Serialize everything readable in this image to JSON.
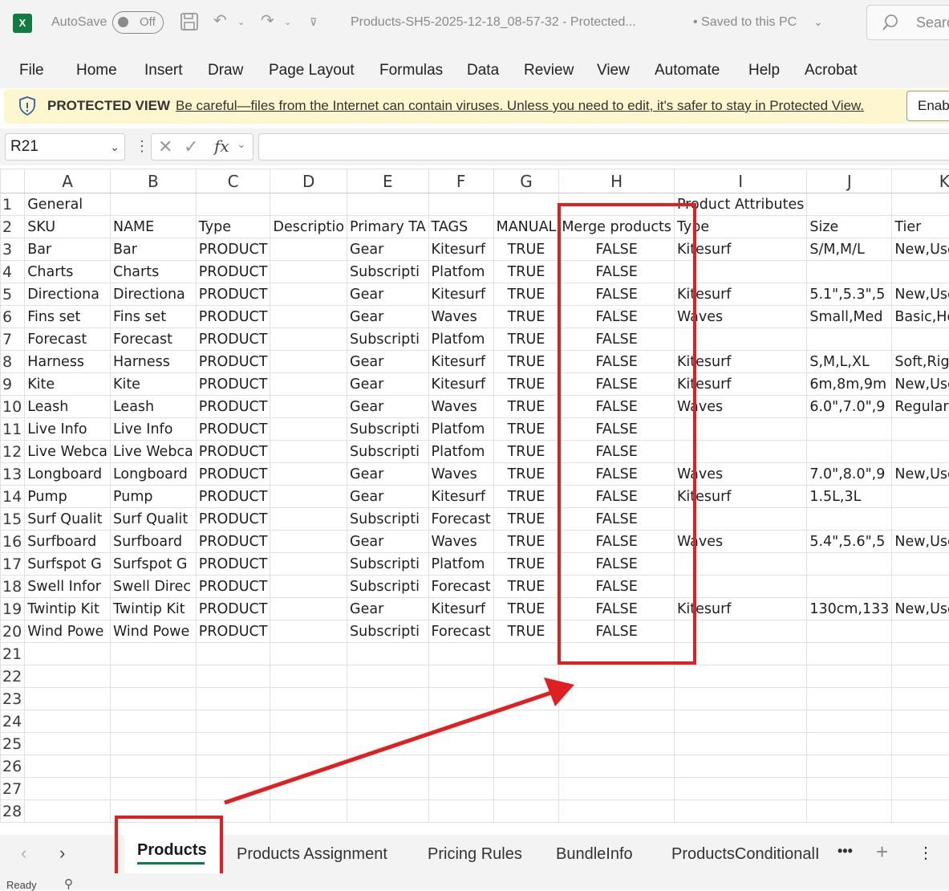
{
  "titlebar": {
    "autosave_label": "AutoSave",
    "toggle_label": "Off",
    "filename": "Products-SH5-2025-12-18_08-57-32  -  Protected...",
    "saved_status": "•  Saved to this PC",
    "search_placeholder": "Searc"
  },
  "menu": [
    "File",
    "Home",
    "Insert",
    "Draw",
    "Page Layout",
    "Formulas",
    "Data",
    "Review",
    "View",
    "Automate",
    "Help",
    "Acrobat"
  ],
  "protected_view": {
    "label": "PROTECTED VIEW",
    "message": "Be careful—files from the Internet can contain viruses. Unless you need to edit, it's safer to stay in Protected View.",
    "button": "Enabl"
  },
  "formula_bar": {
    "name_box": "R21",
    "fx": "fx",
    "formula": ""
  },
  "columns": [
    "A",
    "B",
    "C",
    "D",
    "E",
    "F",
    "G",
    "H",
    "I",
    "J",
    "K"
  ],
  "rows": [
    [
      "General",
      "",
      "",
      "",
      "",
      "",
      "",
      "",
      "Product Attributes",
      "",
      ""
    ],
    [
      "SKU",
      "NAME",
      "Type",
      "Descriptio",
      "Primary TA",
      "TAGS",
      "MANUAL",
      "Merge products",
      "Type",
      "Size",
      "Tier"
    ],
    [
      "Bar",
      "Bar",
      "PRODUCT",
      "",
      "Gear",
      "Kitesurf",
      "TRUE",
      "FALSE",
      "Kitesurf",
      "S/M,M/L",
      "New,Used"
    ],
    [
      "Charts",
      "Charts",
      "PRODUCT",
      "",
      "Subscripti",
      "Platfom",
      "TRUE",
      "FALSE",
      "",
      "",
      ""
    ],
    [
      "Directiona",
      "Directiona",
      "PRODUCT",
      "",
      "Gear",
      "Kitesurf",
      "TRUE",
      "FALSE",
      "Kitesurf",
      "5.1\",5.3\",5",
      "New,Used"
    ],
    [
      "Fins set",
      "Fins set",
      "PRODUCT",
      "",
      "Gear",
      "Waves",
      "TRUE",
      "FALSE",
      "Waves",
      "Small,Med",
      "Basic,Honeyc"
    ],
    [
      "Forecast",
      "Forecast",
      "PRODUCT",
      "",
      "Subscripti",
      "Platfom",
      "TRUE",
      "FALSE",
      "",
      "",
      ""
    ],
    [
      "Harness",
      "Harness",
      "PRODUCT",
      "",
      "Gear",
      "Kitesurf",
      "TRUE",
      "FALSE",
      "Kitesurf",
      "S,M,L,XL",
      "Soft,Rigid"
    ],
    [
      "Kite",
      "Kite",
      "PRODUCT",
      "",
      "Gear",
      "Kitesurf",
      "TRUE",
      "FALSE",
      "Kitesurf",
      "6m,8m,9m",
      "New,Used - Li"
    ],
    [
      "Leash",
      "Leash",
      "PRODUCT",
      "",
      "Gear",
      "Waves",
      "TRUE",
      "FALSE",
      "Waves",
      "6.0\",7.0\",9",
      "Regular,Comp"
    ],
    [
      "Live Info",
      "Live Info",
      "PRODUCT",
      "",
      "Subscripti",
      "Platfom",
      "TRUE",
      "FALSE",
      "",
      "",
      ""
    ],
    [
      "Live Webca",
      "Live Webca",
      "PRODUCT",
      "",
      "Subscripti",
      "Platfom",
      "TRUE",
      "FALSE",
      "",
      "",
      ""
    ],
    [
      "Longboard",
      "Longboard",
      "PRODUCT",
      "",
      "Gear",
      "Waves",
      "TRUE",
      "FALSE",
      "Waves",
      "7.0\",8.0\",9",
      "New,Used - Li"
    ],
    [
      "Pump",
      "Pump",
      "PRODUCT",
      "",
      "Gear",
      "Kitesurf",
      "TRUE",
      "FALSE",
      "Kitesurf",
      "1.5L,3L",
      ""
    ],
    [
      "Surf Qualit",
      "Surf Qualit",
      "PRODUCT",
      "",
      "Subscripti",
      "Forecast",
      "TRUE",
      "FALSE",
      "",
      "",
      ""
    ],
    [
      "Surfboard",
      "Surfboard",
      "PRODUCT",
      "",
      "Gear",
      "Waves",
      "TRUE",
      "FALSE",
      "Waves",
      "5.4\",5.6\",5",
      "New,Used - Li"
    ],
    [
      "Surfspot G",
      "Surfspot G",
      "PRODUCT",
      "",
      "Subscripti",
      "Platfom",
      "TRUE",
      "FALSE",
      "",
      "",
      ""
    ],
    [
      "Swell Infor",
      "Swell Direc",
      "PRODUCT",
      "",
      "Subscripti",
      "Forecast",
      "TRUE",
      "FALSE",
      "",
      "",
      ""
    ],
    [
      "Twintip Kit",
      "Twintip Kit",
      "PRODUCT",
      "",
      "Gear",
      "Kitesurf",
      "TRUE",
      "FALSE",
      "Kitesurf",
      "130cm,133",
      "New,Used"
    ],
    [
      "Wind Powe",
      "Wind Powe",
      "PRODUCT",
      "",
      "Subscripti",
      "Forecast",
      "TRUE",
      "FALSE",
      "",
      "",
      ""
    ],
    [
      "",
      "",
      "",
      "",
      "",
      "",
      "",
      "",
      "",
      "",
      ""
    ],
    [
      "",
      "",
      "",
      "",
      "",
      "",
      "",
      "",
      "",
      "",
      ""
    ],
    [
      "",
      "",
      "",
      "",
      "",
      "",
      "",
      "",
      "",
      "",
      ""
    ],
    [
      "",
      "",
      "",
      "",
      "",
      "",
      "",
      "",
      "",
      "",
      ""
    ],
    [
      "",
      "",
      "",
      "",
      "",
      "",
      "",
      "",
      "",
      "",
      ""
    ],
    [
      "",
      "",
      "",
      "",
      "",
      "",
      "",
      "",
      "",
      "",
      ""
    ],
    [
      "",
      "",
      "",
      "",
      "",
      "",
      "",
      "",
      "",
      "",
      ""
    ],
    [
      "",
      "",
      "",
      "",
      "",
      "",
      "",
      "",
      "",
      "",
      ""
    ]
  ],
  "row_numbers": [
    "1",
    "2",
    "3",
    "4",
    "5",
    "6",
    "7",
    "8",
    "9",
    "10",
    "11",
    "12",
    "13",
    "14",
    "15",
    "16",
    "17",
    "18",
    "19",
    "20",
    "21",
    "22",
    "23",
    "24",
    "25",
    "26",
    "27",
    "28"
  ],
  "sheet_tabs": [
    "Products",
    "Products Assignment",
    "Pricing Rules",
    "BundleInfo",
    "ProductsConditionalI"
  ],
  "active_tab": "Products",
  "status": "Ready",
  "colors": {
    "annotation": "#e02020",
    "excel_green": "#107c41",
    "protected_bg": "#fdf6cf"
  }
}
